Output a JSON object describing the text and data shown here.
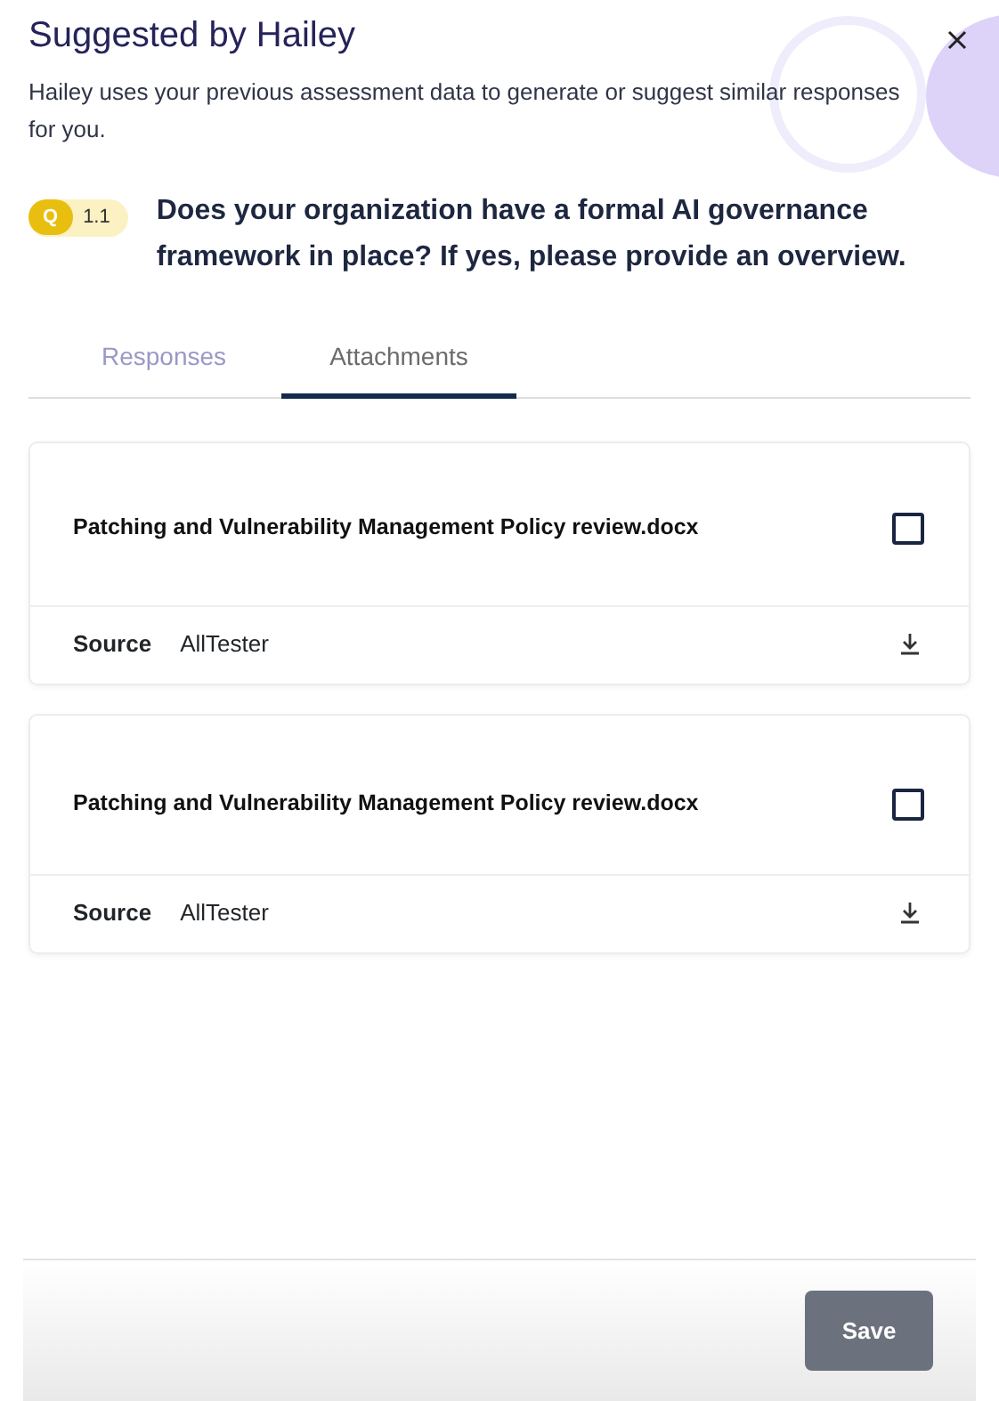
{
  "panel": {
    "title": "Suggested by Hailey",
    "description": "Hailey uses your previous assessment data to generate or suggest similar responses for you."
  },
  "question": {
    "badge": "Q",
    "number": "1.1",
    "text": "Does your organization have a formal AI governance framework in place? If yes, please provide an overview."
  },
  "tabs": [
    {
      "label": "Responses",
      "selected": false
    },
    {
      "label": "Attachments",
      "selected": true
    }
  ],
  "attachments": [
    {
      "name": "Patching and Vulnerability Management Policy review.docx",
      "checked": false,
      "source_label": "Source",
      "source": "AllTester"
    },
    {
      "name": "Patching and Vulnerability Management Policy review.docx",
      "checked": false,
      "source_label": "Source",
      "source": "AllTester"
    }
  ],
  "save_button": {
    "label": "Save",
    "disabled": true
  }
}
